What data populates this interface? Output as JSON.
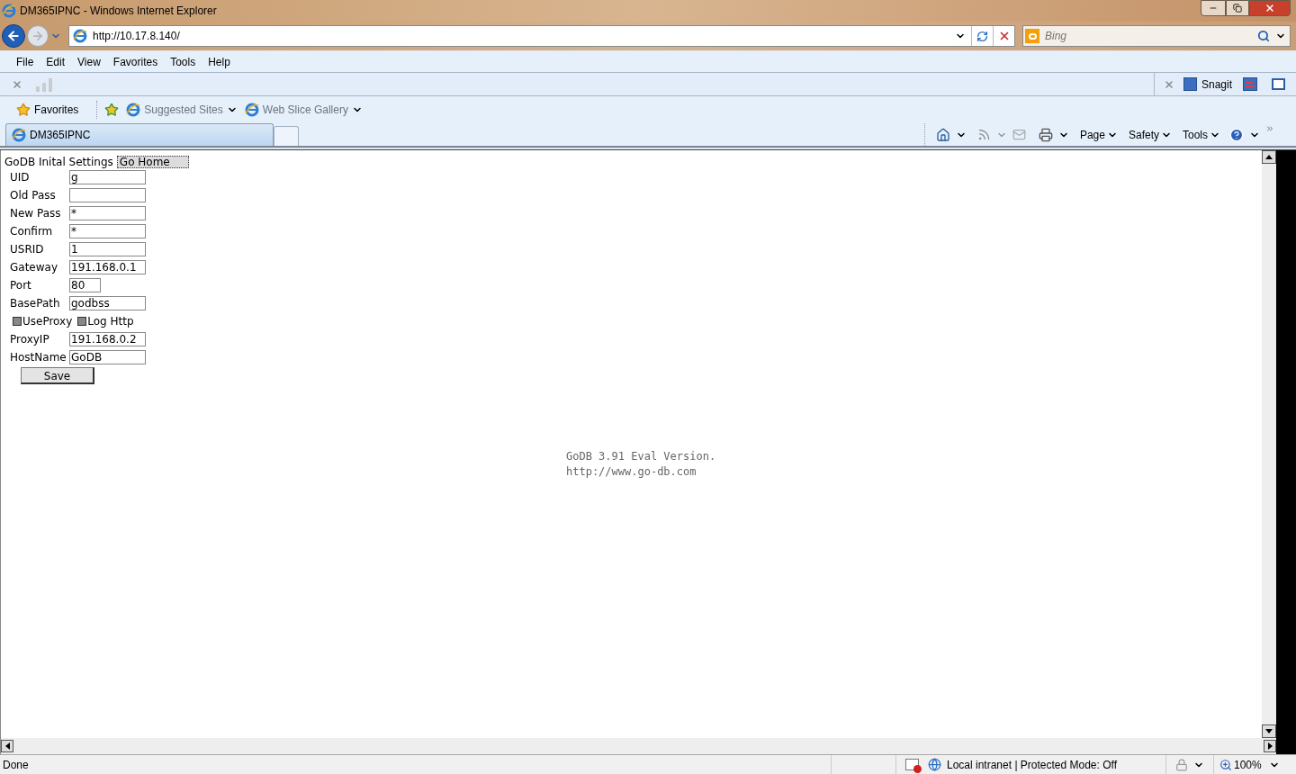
{
  "window": {
    "title": "DM365IPNC - Windows Internet Explorer"
  },
  "address": {
    "url": "http://10.17.8.140/"
  },
  "search": {
    "placeholder": "Bing"
  },
  "menu": [
    "File",
    "Edit",
    "View",
    "Favorites",
    "Tools",
    "Help"
  ],
  "addon_bar": {
    "label": "Snagit"
  },
  "favorites_bar": {
    "label": "Favorites",
    "links": [
      "Suggested Sites",
      "Web Slice Gallery"
    ]
  },
  "tabs": [
    {
      "label": "DM365IPNC",
      "selected": true
    }
  ],
  "command_bar": [
    "Page",
    "Safety",
    "Tools"
  ],
  "page": {
    "title": "GoDB Inital Settings",
    "home_button": "Go Home",
    "rows": [
      {
        "kind": "field",
        "label": "UID",
        "value": "g"
      },
      {
        "kind": "field",
        "label": "Old Pass",
        "value": ""
      },
      {
        "kind": "field",
        "label": "New Pass",
        "value": "*"
      },
      {
        "kind": "field",
        "label": "Confirm",
        "value": "*"
      },
      {
        "kind": "field",
        "label": "USRID",
        "value": "1"
      },
      {
        "kind": "field",
        "label": "Gateway",
        "value": "191.168.0.1"
      },
      {
        "kind": "short-field",
        "label": "Port",
        "value": "80"
      },
      {
        "kind": "field",
        "label": "BasePath",
        "value": "godbss"
      },
      {
        "kind": "checkboxes",
        "items": [
          {
            "label": "UseProxy",
            "checked": false
          },
          {
            "label": "Log Http",
            "checked": false
          }
        ]
      },
      {
        "kind": "field",
        "label": "ProxyIP",
        "value": "191.168.0.2"
      },
      {
        "kind": "field",
        "label": "HostName",
        "value": "GoDB"
      }
    ],
    "save_button": "Save",
    "footer": [
      "GoDB 3.91 Eval Version.",
      "http://www.go-db.com"
    ]
  },
  "status_bar": {
    "text": "Done",
    "zone": "Local intranet | Protected Mode: Off",
    "zoom": "100%"
  }
}
